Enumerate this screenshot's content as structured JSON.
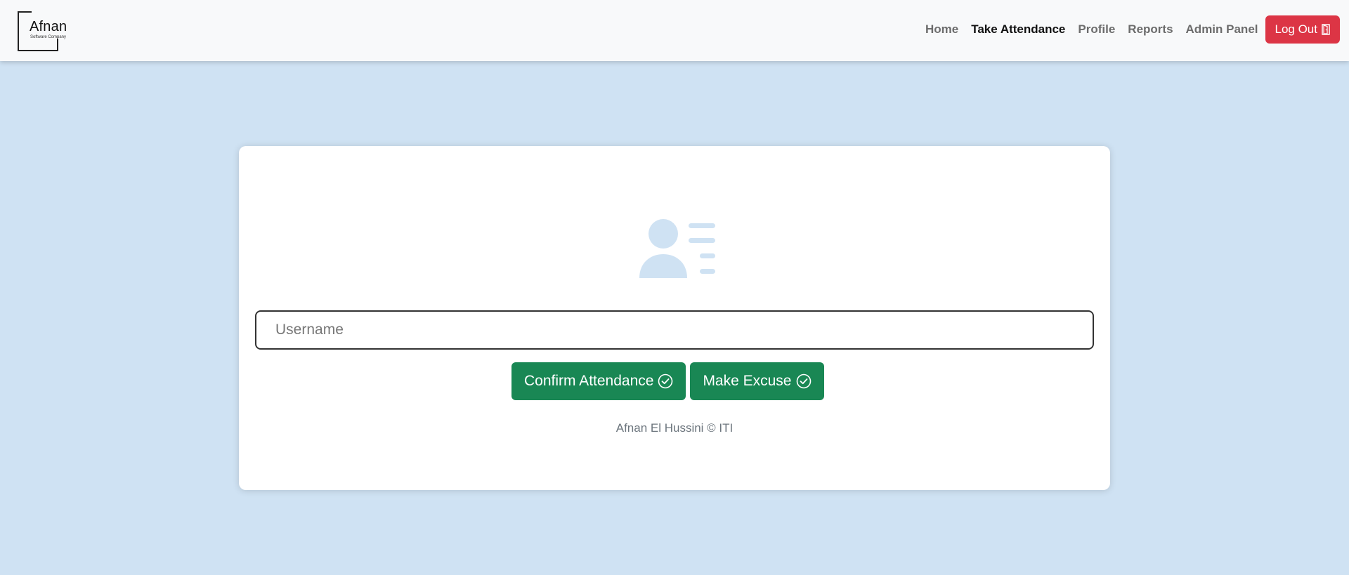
{
  "brand": {
    "name": "Afnan",
    "tagline": "Software Company"
  },
  "nav": {
    "links": [
      {
        "label": "Home",
        "active": false
      },
      {
        "label": "Take Attendance",
        "active": true
      },
      {
        "label": "Profile",
        "active": false
      },
      {
        "label": "Reports",
        "active": false
      },
      {
        "label": "Admin Panel",
        "active": false
      }
    ],
    "logout_label": "Log Out",
    "logout_icon": "door-icon"
  },
  "card": {
    "icon": "user-list-icon",
    "username_placeholder": "Username",
    "username_value": "",
    "confirm_label": "Confirm Attendance",
    "excuse_label": "Make Excuse",
    "button_icon": "check-circle-icon",
    "footer": "Afnan El Hussini © ITI"
  },
  "colors": {
    "page_bg": "#cfe2f3",
    "navbar_bg": "#f8f9fa",
    "logout_bg": "#dc3545",
    "button_green": "#198754",
    "icon_tint": "#cfe2f3"
  }
}
